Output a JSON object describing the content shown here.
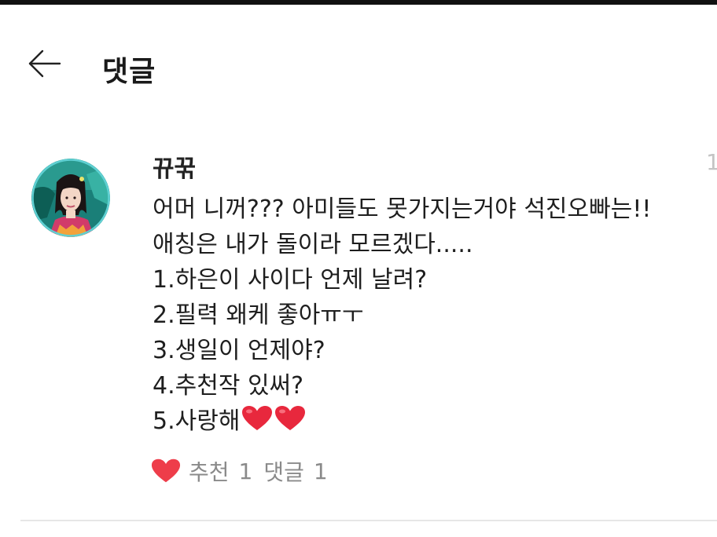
{
  "header": {
    "title": "댓글"
  },
  "comment": {
    "author": "뀨꾺",
    "edge_digit": "1",
    "lines": [
      "어머 니꺼??? 아미들도 못가지는거야 석진오빠는!!",
      "애칭은 내가 돌이라 모르겠다.....",
      "1.하은이 사이다 언제 날려?",
      "2.필력 왜케 좋아ㅠㅜ",
      "3.생일이 언제야?",
      "4.추천작 있써?",
      "5.사랑해"
    ],
    "likes_label": "추천",
    "likes_count": "1",
    "replies_label": "댓글",
    "replies_count": "1"
  },
  "colors": {
    "heart": "#ee3d4a",
    "action_text": "#8a8a8a",
    "avatar_ring": "#5fd0d3"
  },
  "icons": [
    "back-arrow-icon",
    "heart-icon",
    "red-heart-emoji"
  ]
}
